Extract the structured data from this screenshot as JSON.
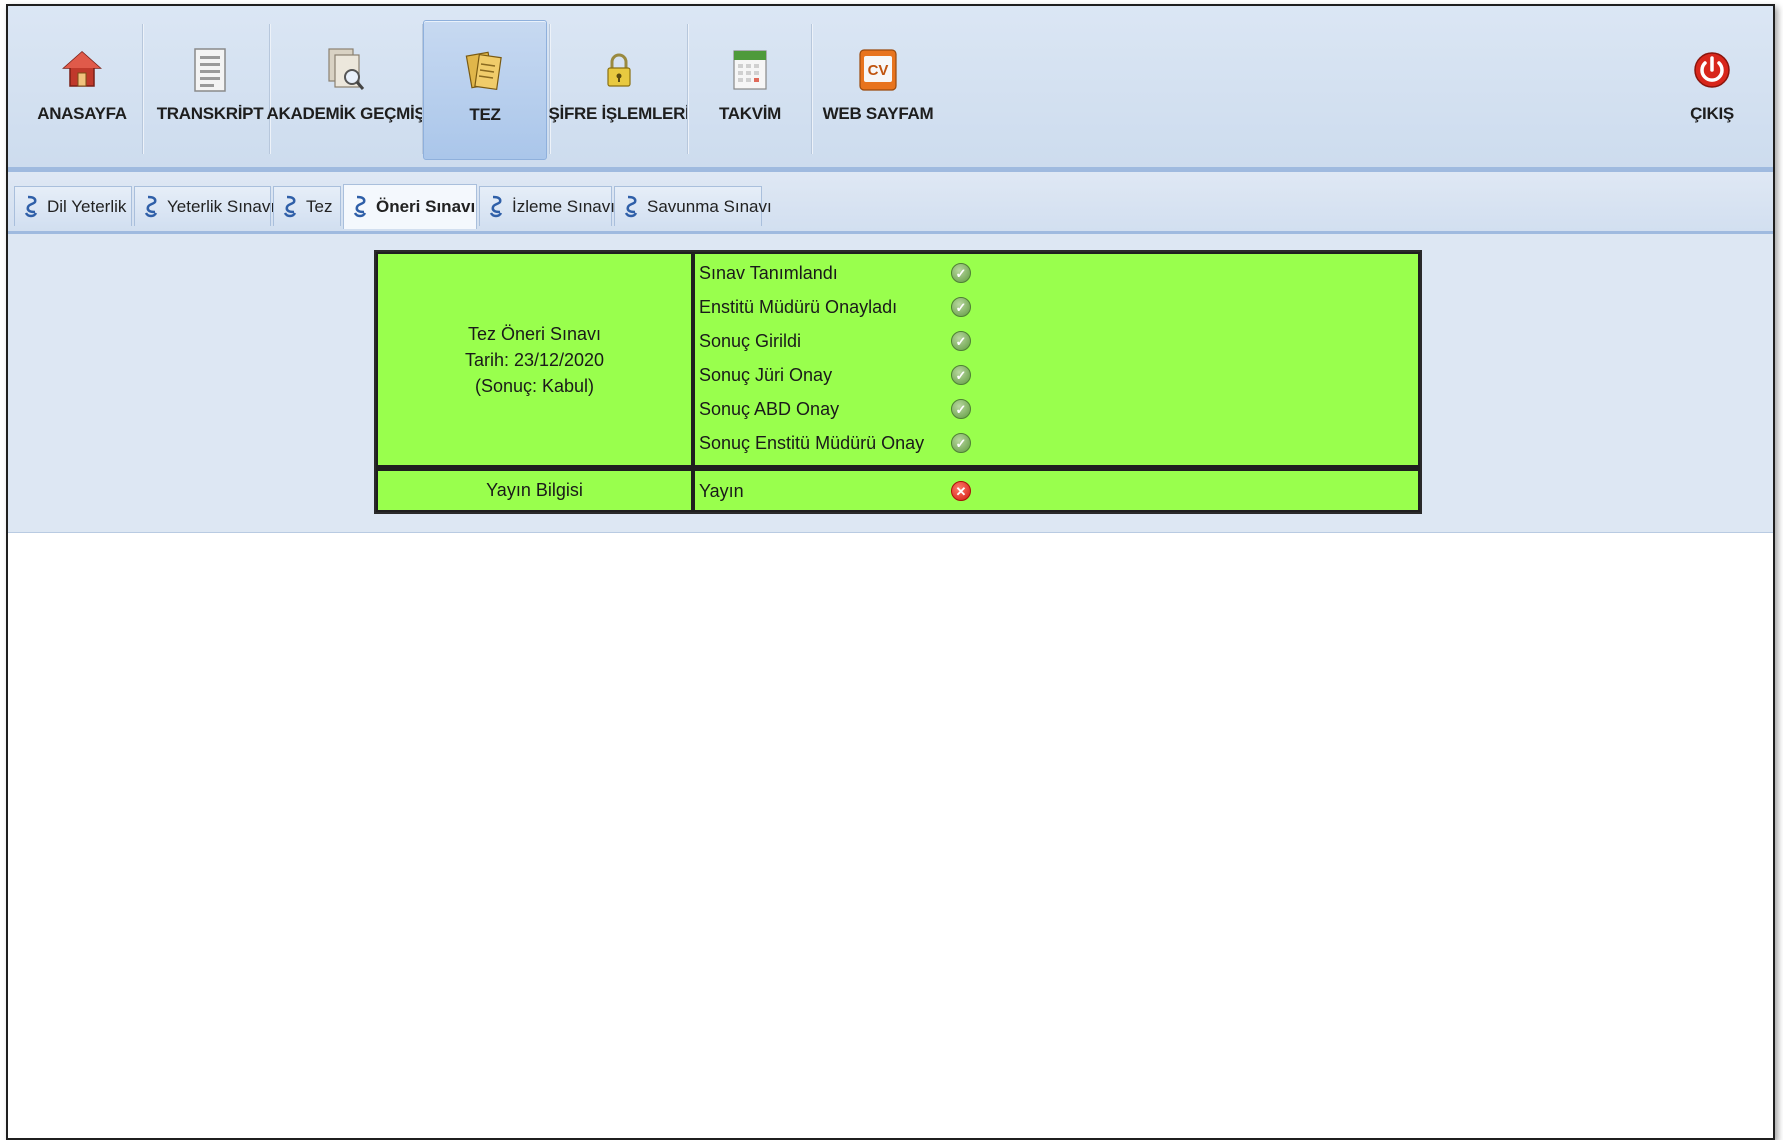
{
  "nav": {
    "items": [
      {
        "label": "ANASAYFA",
        "icon": "home-icon"
      },
      {
        "label": "TRANSKRİPT",
        "icon": "document-icon"
      },
      {
        "label": "AKADEMİK GEÇMİŞ",
        "icon": "document-search-icon"
      },
      {
        "label": "TEZ",
        "icon": "papers-icon"
      },
      {
        "label": "ŞİFRE İŞLEMLERİ",
        "icon": "lock-icon"
      },
      {
        "label": "TAKVİM",
        "icon": "calendar-icon"
      },
      {
        "label": "WEB SAYFAM",
        "icon": "cv-icon",
        "badge": "CV"
      }
    ],
    "logout": {
      "label": "ÇIKIŞ",
      "icon": "power-icon"
    },
    "active_index": 3
  },
  "tabs": {
    "items": [
      {
        "label": "Dil Yeterlik"
      },
      {
        "label": "Yeterlik Sınavı"
      },
      {
        "label": "Tez"
      },
      {
        "label": "Öneri Sınavı"
      },
      {
        "label": "İzleme Sınavı"
      },
      {
        "label": "Savunma Sınavı"
      }
    ],
    "active_index": 3
  },
  "exam": {
    "title": "Tez Öneri Sınavı",
    "date": "Tarih: 23/12/2020",
    "result": "(Sonuç: Kabul)",
    "steps": [
      {
        "label": "Sınav Tanımlandı",
        "status": "ok"
      },
      {
        "label": "Enstitü Müdürü Onayladı",
        "status": "ok"
      },
      {
        "label": "Sonuç Girildi",
        "status": "ok"
      },
      {
        "label": "Sonuç Jüri Onay",
        "status": "ok"
      },
      {
        "label": "Sonuç ABD Onay",
        "status": "ok"
      },
      {
        "label": "Sonuç Enstitü Müdürü Onay",
        "status": "ok"
      }
    ]
  },
  "publication": {
    "title": "Yayın Bilgisi",
    "label": "Yayın",
    "status": "fail"
  },
  "colors": {
    "cell_green": "#99ff4d",
    "toolbar_bg": "#d6e2f2",
    "accent_blue": "#9fbadf"
  }
}
